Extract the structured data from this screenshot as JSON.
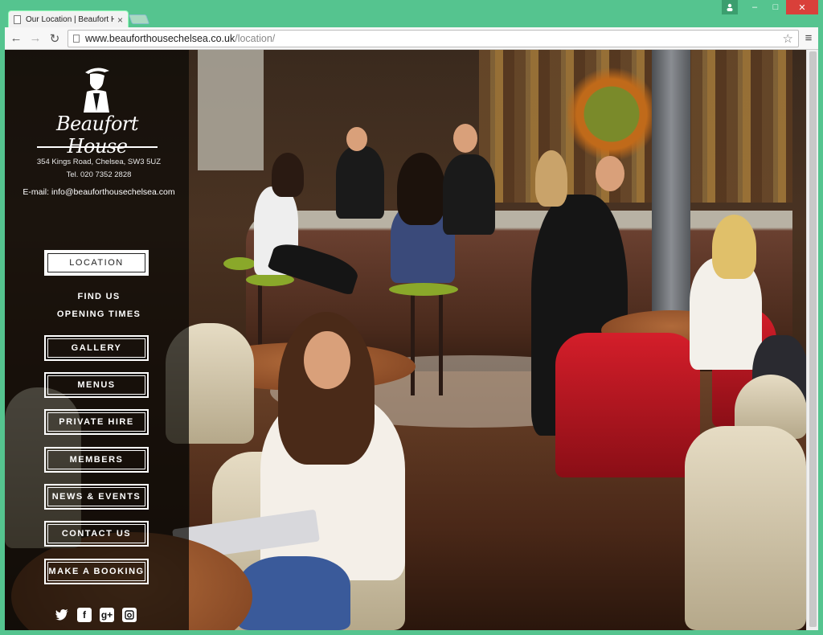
{
  "browser": {
    "tab_title": "Our Location | Beaufort Ho",
    "tab_close": "×",
    "url_host": "www.beauforthousechelsea.co.uk",
    "url_path": "/location/",
    "back": "←",
    "forward": "→",
    "reload": "↻",
    "star": "☆",
    "menu": "≡",
    "win_user": "👤",
    "win_min": "–",
    "win_max": "□",
    "win_close": "✕"
  },
  "site": {
    "logo_text": "Beaufort House",
    "address_line": "354 Kings Road, Chelsea, SW3 5UZ",
    "tel_line": "Tel. 020 7352 2828",
    "email_line": "E-mail: info@beauforthousechelsea.com"
  },
  "nav": {
    "location": "LOCATION",
    "find_us": "FIND US",
    "opening_times": "OPENING TIMES",
    "gallery": "GALLERY",
    "menus": "MENUS",
    "private_hire": "PRIVATE HIRE",
    "members": "MEMBERS",
    "news_events": "NEWS & EVENTS",
    "contact_us": "CONTACT US",
    "make_booking": "MAKE A BOOKING"
  },
  "social": {
    "twitter": "t",
    "facebook": "f",
    "googleplus": "g+",
    "instagram": "◙"
  },
  "colors": {
    "window_frame": "#55c48f",
    "sidebar_overlay": "rgba(10,8,6,0.72)",
    "close_button": "#d9403a"
  }
}
